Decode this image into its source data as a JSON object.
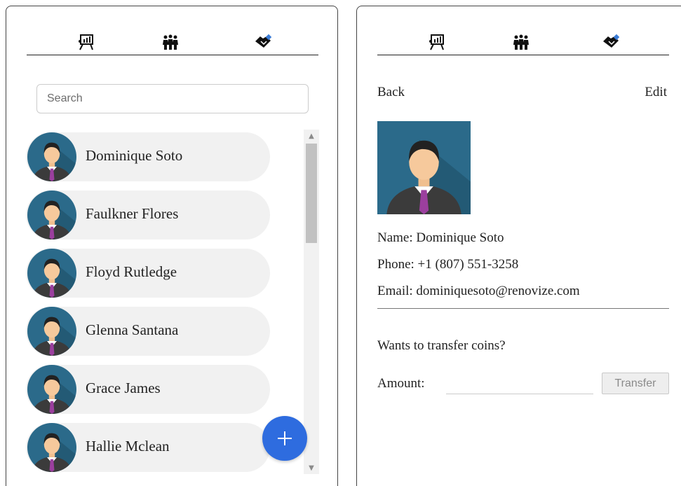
{
  "colors": {
    "fab": "#2e6cdf",
    "contact_bg": "#f1f1f1",
    "avatar_bg": "#2b6a8a",
    "tie": "#9b3f9e"
  },
  "nav_icons": [
    "presentation-chart-icon",
    "team-group-icon",
    "handshake-icon"
  ],
  "search": {
    "placeholder": "Search",
    "value": ""
  },
  "contacts": [
    {
      "name": "Dominique Soto"
    },
    {
      "name": "Faulkner Flores"
    },
    {
      "name": "Floyd Rutledge"
    },
    {
      "name": "Glenna Santana"
    },
    {
      "name": "Grace James"
    },
    {
      "name": "Hallie Mclean"
    }
  ],
  "fab": {
    "icon": "plus-icon",
    "label": "+"
  },
  "detail": {
    "back_label": "Back",
    "edit_label": "Edit",
    "name_line": "Name: Dominique Soto",
    "phone_line": "Phone: +1 (807) 551-3258",
    "email_line": "Email: dominiquesoto@renovize.com",
    "transfer_prompt": "Wants to transfer coins?",
    "amount_label": "Amount:",
    "amount_value": "",
    "transfer_label": "Transfer"
  }
}
